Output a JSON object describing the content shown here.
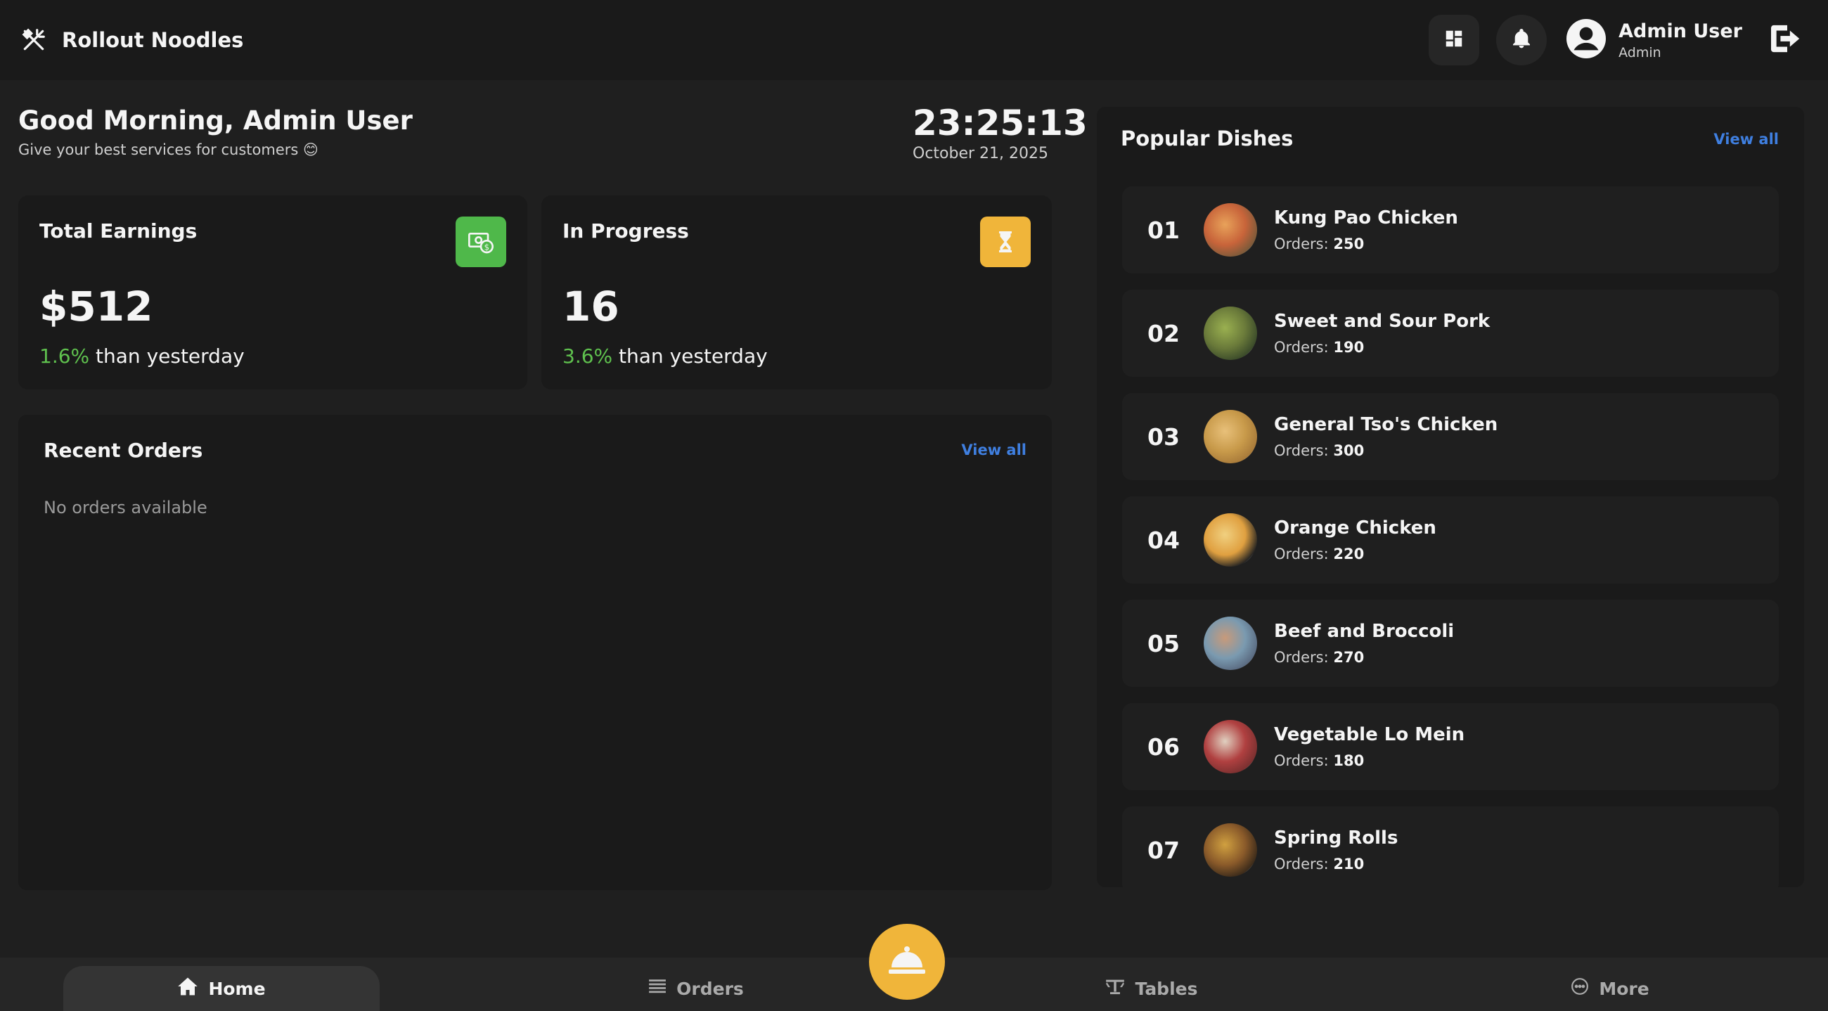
{
  "header": {
    "brand_name": "Rollout Noodles",
    "brand_icon": "fork-knife-icon",
    "user_name": "Admin User",
    "user_role": "Admin"
  },
  "greeting": {
    "title": "Good Morning, Admin User",
    "subtitle": "Give your best services for customers 😊"
  },
  "clock": {
    "time": "23:25:13",
    "date": "October 21, 2025"
  },
  "stats": {
    "earnings": {
      "title": "Total Earnings",
      "value": "$512",
      "pct": "1.6%",
      "suffix": " than yesterday",
      "badge_color": "#4fb84a"
    },
    "in_progress": {
      "title": "In Progress",
      "value": "16",
      "pct": "3.6%",
      "suffix": " than yesterday",
      "badge_color": "#f0b53a"
    }
  },
  "recent_orders": {
    "title": "Recent Orders",
    "view_all": "View all",
    "empty_text": "No orders available"
  },
  "popular_dishes": {
    "title": "Popular Dishes",
    "view_all": "View all",
    "orders_label": "Orders:",
    "items": [
      {
        "rank": "01",
        "name": "Kung Pao Chicken",
        "orders": "250"
      },
      {
        "rank": "02",
        "name": "Sweet and Sour Pork",
        "orders": "190"
      },
      {
        "rank": "03",
        "name": "General Tso's Chicken",
        "orders": "300"
      },
      {
        "rank": "04",
        "name": "Orange Chicken",
        "orders": "220"
      },
      {
        "rank": "05",
        "name": "Beef and Broccoli",
        "orders": "270"
      },
      {
        "rank": "06",
        "name": "Vegetable Lo Mein",
        "orders": "180"
      },
      {
        "rank": "07",
        "name": "Spring Rolls",
        "orders": "210"
      }
    ]
  },
  "bottom_nav": {
    "home": "Home",
    "orders": "Orders",
    "tables": "Tables",
    "more": "More"
  },
  "colors": {
    "accent_blue": "#3f7fe0",
    "positive_green": "#5fc14e",
    "fab_yellow": "#f0b53a"
  }
}
